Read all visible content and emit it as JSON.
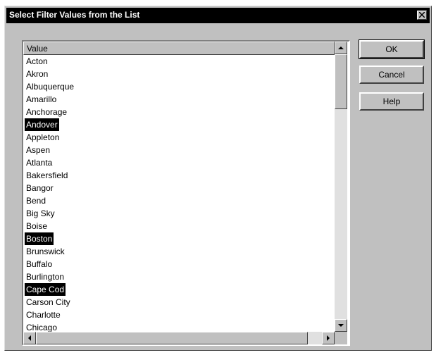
{
  "dialog": {
    "title": "Select Filter Values from the List"
  },
  "list": {
    "column_header": "Value",
    "items": [
      {
        "label": "Acton",
        "selected": false
      },
      {
        "label": "Akron",
        "selected": false
      },
      {
        "label": "Albuquerque",
        "selected": false
      },
      {
        "label": "Amarillo",
        "selected": false
      },
      {
        "label": "Anchorage",
        "selected": false
      },
      {
        "label": "Andover",
        "selected": true
      },
      {
        "label": "Appleton",
        "selected": false
      },
      {
        "label": "Aspen",
        "selected": false
      },
      {
        "label": "Atlanta",
        "selected": false
      },
      {
        "label": "Bakersfield",
        "selected": false
      },
      {
        "label": "Bangor",
        "selected": false
      },
      {
        "label": "Bend",
        "selected": false
      },
      {
        "label": "Big Sky",
        "selected": false
      },
      {
        "label": "Boise",
        "selected": false
      },
      {
        "label": "Boston",
        "selected": true
      },
      {
        "label": "Brunswick",
        "selected": false
      },
      {
        "label": "Buffalo",
        "selected": false
      },
      {
        "label": "Burlington",
        "selected": false
      },
      {
        "label": "Cape Cod",
        "selected": true
      },
      {
        "label": "Carson City",
        "selected": false
      },
      {
        "label": "Charlotte",
        "selected": false
      },
      {
        "label": "Chicago",
        "selected": false
      }
    ]
  },
  "buttons": {
    "ok": "OK",
    "cancel": "Cancel",
    "help": "Help"
  },
  "icons": {
    "close": "close-icon",
    "scroll_up": "arrow-up-icon",
    "scroll_down": "arrow-down-icon",
    "scroll_left": "arrow-left-icon",
    "scroll_right": "arrow-right-icon"
  },
  "colors": {
    "dialog_face": "#c0c0c0",
    "titlebar": "#000000",
    "selection": "#000000"
  }
}
